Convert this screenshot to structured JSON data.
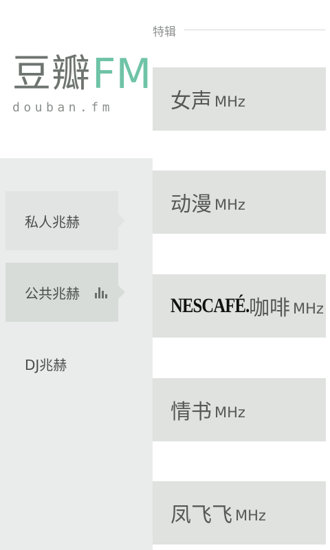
{
  "logo": {
    "cn_text": "豆瓣",
    "fm_text": "FM",
    "sub_text": "douban.fm",
    "colors": {
      "cn": "#6e7470",
      "fm": "#6fc3a6"
    }
  },
  "nav": {
    "items": [
      {
        "label": "私人兆赫"
      },
      {
        "label": "公共兆赫",
        "active": true,
        "icon": "playing-bars-icon"
      },
      {
        "label": "DJ兆赫"
      }
    ]
  },
  "section": {
    "label": "特辑"
  },
  "channels": [
    {
      "name": "女声",
      "unit": "MHz"
    },
    {
      "name": "动漫",
      "unit": "MHz"
    },
    {
      "brand": "NESCAFÉ.",
      "name": "咖啡",
      "unit": "MHz"
    },
    {
      "name": "情书",
      "unit": "MHz"
    },
    {
      "name": "凤飞飞",
      "unit": "MHz"
    }
  ]
}
